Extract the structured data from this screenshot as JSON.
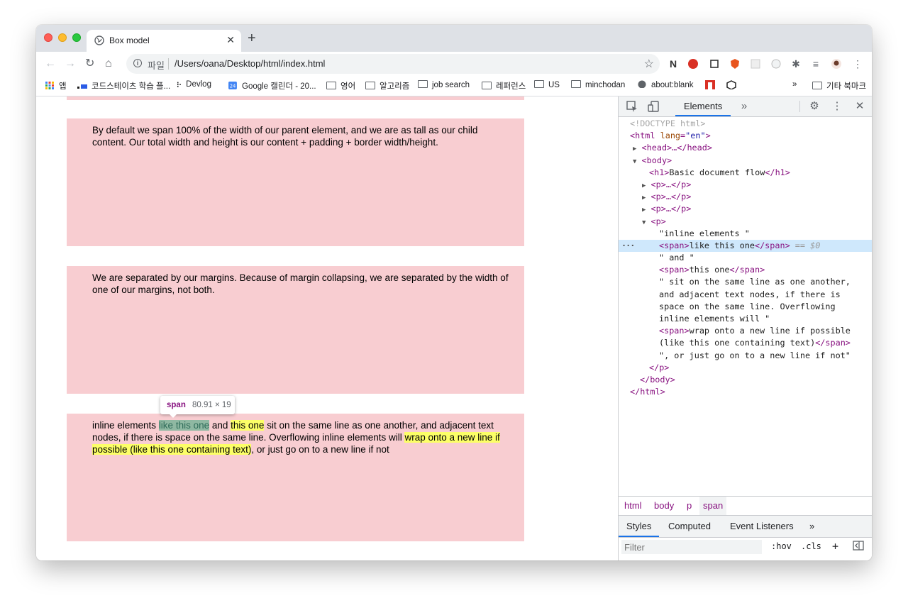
{
  "browser": {
    "tab_title": "Box model",
    "new_tab": "+",
    "url_scheme": "파일",
    "url": "/Users/oana/Desktop/html/index.html"
  },
  "bookmarks": [
    {
      "label": "앱"
    },
    {
      "label": "코드스테이츠 학습 플..."
    },
    {
      "label": "Devlog"
    },
    {
      "label": "Google 캘린더 - 20..."
    },
    {
      "label": "영어"
    },
    {
      "label": "알고리즘"
    },
    {
      "label": "job search"
    },
    {
      "label": "레퍼런스"
    },
    {
      "label": "US"
    },
    {
      "label": "minchodan"
    },
    {
      "label": "about:blank"
    }
  ],
  "bookmarks_overflow": "»",
  "bookmarks_other": "기타 북마크",
  "calendar_day": "24",
  "page": {
    "box1": "By default we span 100% of the width of our parent element, and we are as tall as our child content. Our total width and height is our content + padding + border width/height.",
    "box2": "We are separated by our margins. Because of margin collapsing, we are separated by the width of one of our margins, not both.",
    "box3": {
      "t1": "inline elements ",
      "span1": "like this one",
      "t2": " and ",
      "span2": "this one",
      "t3": " sit on the same line as one another, and adjacent text nodes, if there is space on the same line. Overflowing inline elements will ",
      "span3": "wrap onto a new line if possible (like this one containing text)",
      "t4": ", or just go on to a new line if not"
    },
    "tooltip_tag": "span",
    "tooltip_dims": "80.91 × 19"
  },
  "devtools": {
    "tab": "Elements",
    "more": "»",
    "dom": {
      "doctype": "<!DOCTYPE html>",
      "html_open": "<html",
      "lang_attr": "lang",
      "lang_val": "\"en\"",
      "gt": ">",
      "head": "<head>…</head>",
      "body_open": "<body>",
      "h1_open": "<h1>",
      "h1_text": "Basic document flow",
      "h1_close": "</h1>",
      "p_collapsed": "<p>…</p>",
      "p_open": "<p>",
      "txt1": "\"inline elements \"",
      "span_open": "<span>",
      "span_close": "</span>",
      "span1_text": "like this one",
      "eq0": " == $0",
      "txt2": "\" and \"",
      "span2_text": "this one",
      "txt3": "\" sit on the same line as one another, and adjacent text nodes, if there is space on the same line. Overflowing inline elements will \"",
      "span3_text": "wrap onto a new line if possible (like this one containing text)",
      "txt4": "\", or just go on to a new line if not\"",
      "p_close": "</p>",
      "body_close": "</body>",
      "html_close": "</html>"
    },
    "breadcrumbs": [
      "html",
      "body",
      "p",
      "span"
    ],
    "style_tabs": [
      "Styles",
      "Computed",
      "Event Listeners"
    ],
    "style_more": "»",
    "filter_placeholder": "Filter",
    "hov": ":hov",
    "cls": ".cls"
  },
  "colors": {
    "box_bg": "#f8cdd1",
    "span_highlight": "#8fb8a2",
    "span_yellow": "#fcff67",
    "selected_node": "#cfe8fc",
    "accent": "#1a73e8"
  }
}
